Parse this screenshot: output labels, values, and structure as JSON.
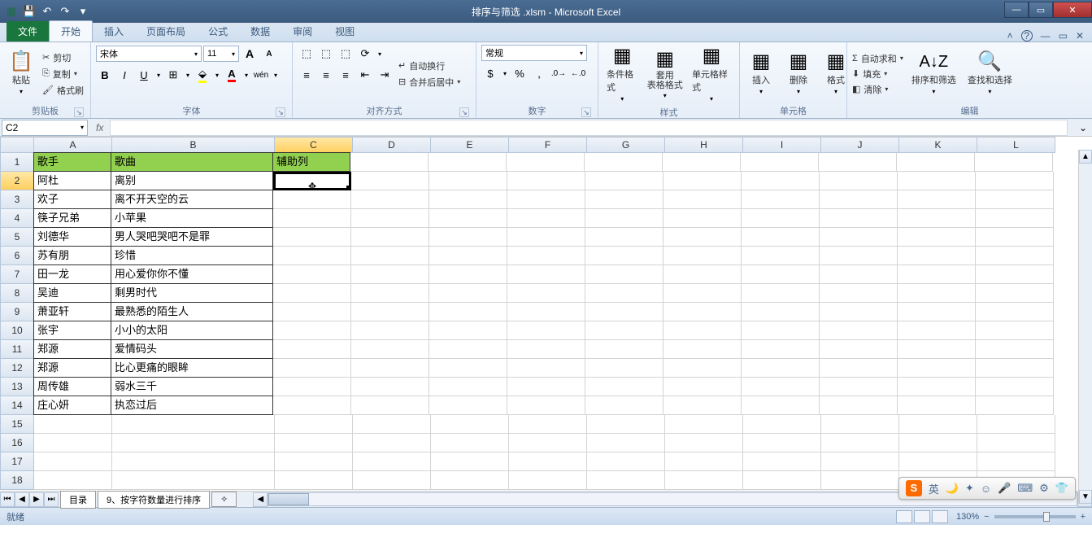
{
  "title": "排序与筛选 .xlsm - Microsoft Excel",
  "qat": {
    "save": "💾",
    "undo": "↶",
    "redo": "↷"
  },
  "win": {
    "min": "—",
    "max": "▭",
    "close": "✕"
  },
  "tabs": {
    "file": "文件",
    "items": [
      "开始",
      "插入",
      "页面布局",
      "公式",
      "数据",
      "审阅",
      "视图"
    ],
    "active": "开始"
  },
  "help": {
    "expand": "˄",
    "q": "?"
  },
  "ribbon": {
    "clipboard": {
      "name": "剪贴板",
      "paste": "粘贴",
      "cut": "剪切",
      "copy": "复制",
      "painter": "格式刷"
    },
    "font": {
      "name": "字体",
      "face": "宋体",
      "size": "11",
      "bold": "B",
      "italic": "I",
      "underline": "U",
      "grow": "A",
      "shrink": "A"
    },
    "align": {
      "name": "对齐方式",
      "wrap": "自动换行",
      "merge": "合并后居中"
    },
    "number": {
      "name": "数字",
      "format": "常规"
    },
    "styles": {
      "name": "样式",
      "cond": "条件格式",
      "table": "套用\n表格格式",
      "cell": "单元格样式"
    },
    "cells": {
      "name": "单元格",
      "insert": "插入",
      "delete": "删除",
      "format": "格式"
    },
    "editing": {
      "name": "编辑",
      "autosum": "自动求和",
      "fill": "填充",
      "clear": "清除",
      "sort": "排序和筛选",
      "find": "查找和选择"
    }
  },
  "namebox": "C2",
  "columns": [
    "A",
    "B",
    "C",
    "D",
    "E",
    "F",
    "G",
    "H",
    "I",
    "J",
    "K",
    "L"
  ],
  "header_row": {
    "A": "歌手",
    "B": "歌曲",
    "C": "辅助列"
  },
  "data_rows": [
    {
      "n": 2,
      "A": "阿杜",
      "B": "离别"
    },
    {
      "n": 3,
      "A": "欢子",
      "B": "离不开天空的云"
    },
    {
      "n": 4,
      "A": "筷子兄弟",
      "B": "小苹果"
    },
    {
      "n": 5,
      "A": "刘德华",
      "B": "男人哭吧哭吧不是罪"
    },
    {
      "n": 6,
      "A": "苏有朋",
      "B": "珍惜"
    },
    {
      "n": 7,
      "A": "田一龙",
      "B": "用心爱你你不懂"
    },
    {
      "n": 8,
      "A": "吴迪",
      "B": "剩男时代"
    },
    {
      "n": 9,
      "A": "萧亚轩",
      "B": "最熟悉的陌生人"
    },
    {
      "n": 10,
      "A": "张宇",
      "B": "小小的太阳"
    },
    {
      "n": 11,
      "A": "郑源",
      "B": "爱情码头"
    },
    {
      "n": 12,
      "A": "郑源",
      "B": "比心更痛的眼眸"
    },
    {
      "n": 13,
      "A": "周传雄",
      "B": "弱水三千"
    },
    {
      "n": 14,
      "A": "庄心妍",
      "B": "执恋过后"
    }
  ],
  "empty_rows": [
    15,
    16,
    17,
    18
  ],
  "sheets": [
    "目录",
    "9、按字符数量进行排序"
  ],
  "status": {
    "ready": "就绪",
    "zoom": "130%"
  },
  "ime": {
    "logo": "S",
    "lang": "英",
    "icons": [
      "🌙",
      "✦",
      "☺",
      "🎤",
      "⌨",
      "⚙",
      "👕"
    ]
  },
  "selected_cell": "C2",
  "selected_row": 2,
  "selected_col": "C"
}
